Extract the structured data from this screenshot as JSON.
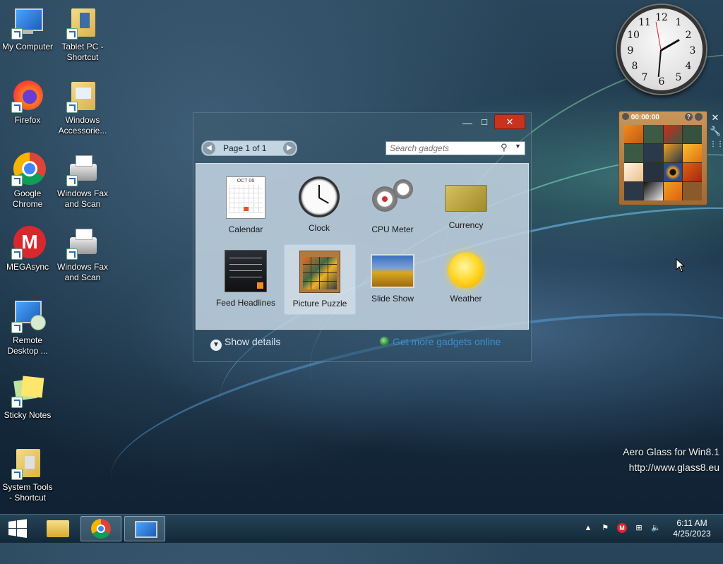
{
  "desktop_icons": [
    {
      "label": "My Computer",
      "icon": "computer-icon"
    },
    {
      "label": "Tablet PC - Shortcut",
      "icon": "folder-icon"
    },
    {
      "label": "Firefox",
      "icon": "firefox-icon"
    },
    {
      "label": "Windows Accessorie...",
      "icon": "folder-icon"
    },
    {
      "label": "Google Chrome",
      "icon": "chrome-icon"
    },
    {
      "label": "Windows Fax and Scan",
      "icon": "fax-icon"
    },
    {
      "label": "MEGAsync",
      "icon": "mega-icon"
    },
    {
      "label": "Windows Fax and Scan",
      "icon": "fax-icon"
    },
    {
      "label": "Remote Desktop ...",
      "icon": "remote-desktop-icon"
    },
    {
      "label": "Sticky Notes",
      "icon": "sticky-notes-icon"
    },
    {
      "label": "System Tools - Shortcut",
      "icon": "folder-icon"
    }
  ],
  "gallery": {
    "close_label": "✕",
    "minimize_label": "—",
    "maximize_label": "☐",
    "page_label": "Page 1 of 1",
    "search_placeholder": "Search gadgets",
    "gadgets": [
      {
        "label": "Calendar",
        "icon": "calendar-icon"
      },
      {
        "label": "Clock",
        "icon": "clock-icon"
      },
      {
        "label": "CPU Meter",
        "icon": "cpu-meter-icon"
      },
      {
        "label": "Currency",
        "icon": "currency-icon"
      },
      {
        "label": "Feed Headlines",
        "icon": "feed-icon"
      },
      {
        "label": "Picture Puzzle",
        "icon": "puzzle-icon",
        "selected": true
      },
      {
        "label": "Slide Show",
        "icon": "slideshow-icon"
      },
      {
        "label": "Weather",
        "icon": "weather-icon"
      }
    ],
    "calendar_month": "OCT 06",
    "show_details": "Show details",
    "get_more": "Get more gadgets online"
  },
  "clock_gadget": {
    "numbers": [
      "12",
      "1",
      "2",
      "3",
      "4",
      "5",
      "6",
      "7",
      "8",
      "9",
      "10",
      "11"
    ]
  },
  "puzzle_gadget": {
    "timer": "00:00:00"
  },
  "branding": {
    "line1": "Aero Glass for Win8.1",
    "line2": "http://www.glass8.eu"
  },
  "taskbar": {
    "time": "6:11 AM",
    "date": "4/25/2023",
    "apps": [
      "file-explorer-icon",
      "chrome-icon",
      "remote-desktop-icon"
    ]
  },
  "colors": {
    "close_red": "#c8331f",
    "link_blue": "#3a8fd0"
  }
}
